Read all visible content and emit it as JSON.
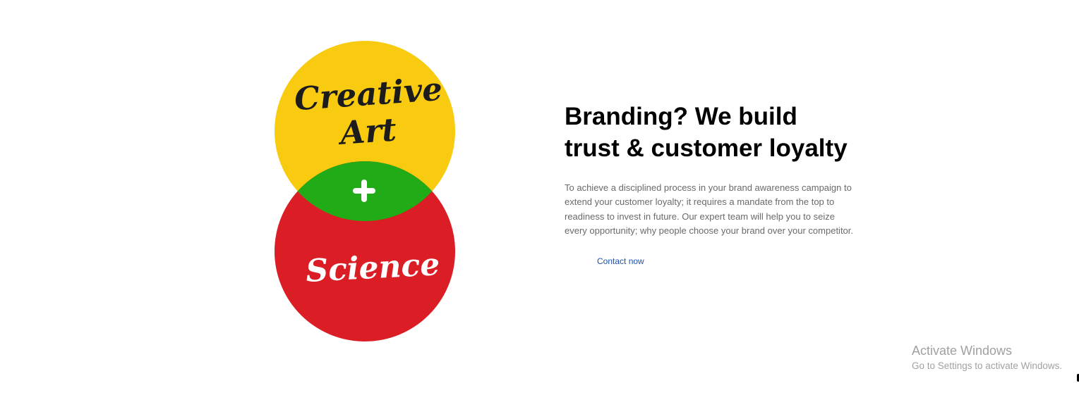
{
  "illustration": {
    "top_label_line1": "Creative",
    "top_label_line2": "Art",
    "middle_symbol": "+",
    "bottom_label": "Science",
    "colors": {
      "top_circle": "#f9cb10",
      "overlap": "#21ab16",
      "bottom_circle": "#db1e25",
      "top_text": "#1c1c1c",
      "bottom_text": "#ffffff"
    }
  },
  "hero": {
    "headline_line1": "Branding? We build",
    "headline_line2": "trust & customer loyalty",
    "body": "To achieve a disciplined process in your brand awareness campaign to extend your customer loyalty; it requires a mandate from the top to readiness to invest in future. Our expert team will help you to seize every opportunity; why people choose your brand over your competitor.",
    "cta_label": "Contact now"
  },
  "watermark": {
    "title": "Activate Windows",
    "subtitle": "Go to Settings to activate Windows."
  }
}
